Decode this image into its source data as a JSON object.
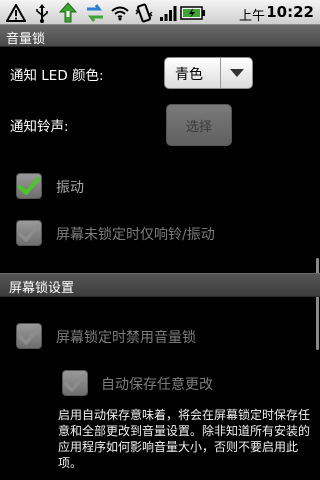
{
  "status_bar": {
    "icons": [
      "warning-icon",
      "usb-icon",
      "download-icon",
      "sync-icon",
      "wifi-icon",
      "vibrate-icon",
      "signal-icon",
      "battery-icon"
    ],
    "ampm": "上午",
    "time": "10:22"
  },
  "title": "音量锁",
  "notification": {
    "led_label": "通知 LED 颜色:",
    "led_value": "青色",
    "ringtone_label": "通知铃声:",
    "ringtone_button": "选择"
  },
  "options": {
    "vibrate": {
      "label": "振动",
      "checked": true
    },
    "unlock_only": {
      "label": "屏幕未锁定时仅响铃/振动",
      "checked": false
    }
  },
  "lock_section": {
    "header": "屏幕锁设置",
    "disable_lock": {
      "label": "屏幕锁定时禁用音量锁",
      "checked": false
    },
    "autosave": {
      "label": "自动保存任意更改",
      "checked": false
    },
    "note": "启用自动保存意味着，将会在屏幕锁定时保存任意和全部更改到音量设置。除非知道所有安装的应用程序如何影响音量大小，否则不要启用此项。"
  },
  "colors": {
    "accent_check": "#4cc52a",
    "checkbox_bg": "#808080",
    "section_bg": "#4a4a4a"
  }
}
